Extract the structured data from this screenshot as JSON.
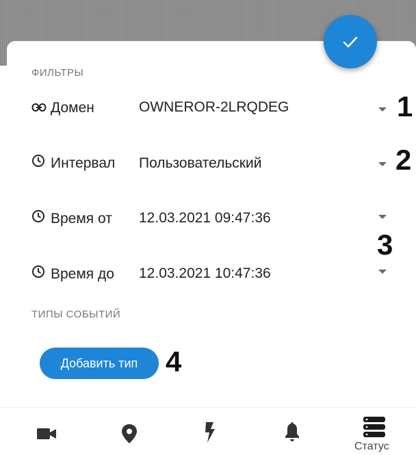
{
  "filters": {
    "title": "ФИЛЬТРЫ",
    "rows": [
      {
        "label": "Домен",
        "value": "OWNEROR-2LRQDEG",
        "icon": "link-icon"
      },
      {
        "label": "Интервал",
        "value": "Пользовательский",
        "icon": "clock-icon"
      },
      {
        "label": "Время от",
        "value": "12.03.2021 09:47:36",
        "icon": "clock-icon"
      },
      {
        "label": "Время до",
        "value": "12.03.2021 10:47:36",
        "icon": "clock-icon"
      }
    ]
  },
  "event_types": {
    "title": "ТИПЫ СОБЫТИЙ",
    "add_button": "Добавить тип"
  },
  "annotations": [
    "1",
    "2",
    "3",
    "4"
  ],
  "bottom_nav": {
    "items": [
      {
        "icon": "video-camera-icon"
      },
      {
        "icon": "map-pin-icon"
      },
      {
        "icon": "lightning-icon"
      },
      {
        "icon": "bell-icon"
      },
      {
        "icon": "server-stack-icon",
        "label": "Статус"
      }
    ]
  },
  "colors": {
    "accent": "#1f85d6",
    "backdrop": "#8e8e8e"
  }
}
